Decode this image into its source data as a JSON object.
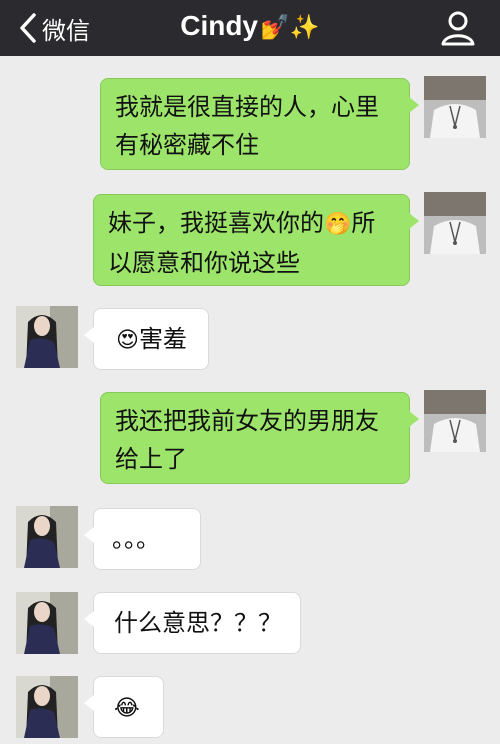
{
  "header": {
    "back_label": "微信",
    "title": "Cindy",
    "title_emoji": "💅✨"
  },
  "messages": [
    {
      "side": "out",
      "line1": "我就是很直接的人，心里",
      "line2": "有秘密藏不住"
    },
    {
      "side": "out",
      "line1_a": "妹子，我挺喜欢你的",
      "line1_emoji": "🤭",
      "line1_b": "所",
      "line2": "以愿意和你说这些"
    },
    {
      "side": "in",
      "emoji": "😍",
      "text": "害羞"
    },
    {
      "side": "out",
      "line1": "我还把我前女友的男朋友",
      "line2": "给上了"
    },
    {
      "side": "in",
      "text": "。。。"
    },
    {
      "side": "in",
      "text": "什么意思？？？"
    },
    {
      "side": "in",
      "emoji": "😂"
    }
  ]
}
